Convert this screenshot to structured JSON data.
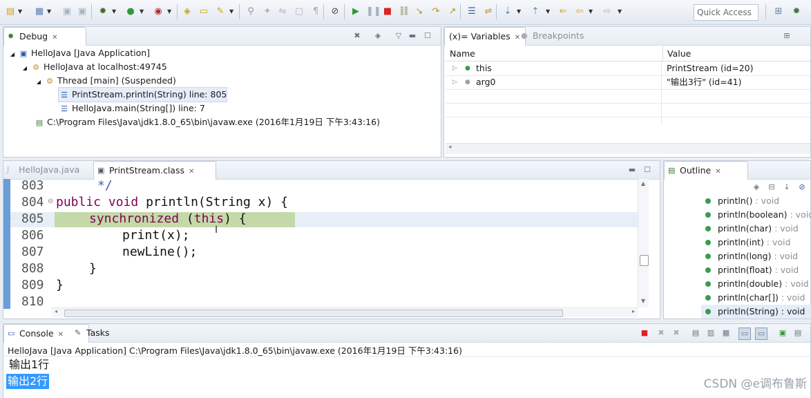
{
  "toolbar": {
    "icons": [
      "new-file-icon",
      "new-wizard-icon",
      "save-icon",
      "save-all-icon",
      "debug-icon",
      "run-icon",
      "external-tools-icon",
      "open-type-icon",
      "open-folder-icon",
      "open-task-icon",
      "search-icon",
      "skip-breakpoints-icon",
      "resume-icon",
      "suspend-icon",
      "terminate-icon",
      "disconnect-icon",
      "step-into-icon",
      "step-over-icon",
      "step-return-icon",
      "drop-to-frame-icon",
      "use-step-filters-icon",
      "next-annotation-icon",
      "back-icon",
      "forward-icon"
    ],
    "quick_access_placeholder": "Quick Access"
  },
  "debug_view": {
    "tab_label": "Debug",
    "tree": [
      {
        "label": "HelloJava [Java Application]",
        "icon": "java-app-icon",
        "level": 0
      },
      {
        "label": "HelloJava at localhost:49745",
        "icon": "vm-icon",
        "level": 1
      },
      {
        "label": "Thread [main] (Suspended)",
        "icon": "thread-icon",
        "level": 2
      },
      {
        "label": "PrintStream.println(String) line: 805",
        "icon": "stack-frame-icon",
        "level": 3,
        "selected": true
      },
      {
        "label": "HelloJava.main(String[]) line: 7",
        "icon": "stack-frame-icon",
        "level": 3
      },
      {
        "label": "C:\\Program Files\\Java\\jdk1.8.0_65\\bin\\javaw.exe (2016年1月19日 下午3:43:16)",
        "icon": "process-icon",
        "level": 1
      }
    ]
  },
  "variables_view": {
    "tab_label": "(x)= Variables",
    "breakpoints_label": "Breakpoints",
    "columns": [
      "Name",
      "Value"
    ],
    "rows": [
      {
        "name": "this",
        "value": "PrintStream  (id=20)"
      },
      {
        "name": "arg0",
        "value": "\"输出3行\" (id=41)"
      }
    ]
  },
  "editor": {
    "tabs": [
      {
        "label": "HelloJava.java",
        "active": false
      },
      {
        "label": "PrintStream.class",
        "active": true
      }
    ],
    "lines": [
      {
        "number": "803",
        "text": "*/",
        "kind": "comment",
        "indent": 1
      },
      {
        "number": "804",
        "text": "public void println(String x) {",
        "kind": "method-decl",
        "indent": 0
      },
      {
        "number": "805",
        "text": "synchronized (this) {",
        "kind": "sync",
        "indent": 1,
        "highlighted": true
      },
      {
        "number": "806",
        "text": "print(x);",
        "kind": "plain",
        "indent": 2
      },
      {
        "number": "807",
        "text": "newLine();",
        "kind": "plain",
        "indent": 2
      },
      {
        "number": "808",
        "text": "}",
        "kind": "plain",
        "indent": 1
      },
      {
        "number": "809",
        "text": "}",
        "kind": "plain",
        "indent": 0
      },
      {
        "number": "810",
        "text": "",
        "kind": "plain",
        "indent": 0
      }
    ],
    "highlight_color": "#c4d9a8"
  },
  "outline_view": {
    "tab_label": "Outline",
    "items": [
      {
        "name": "println()",
        "type": ": void"
      },
      {
        "name": "println(boolean)",
        "type": ": void"
      },
      {
        "name": "println(char)",
        "type": ": void"
      },
      {
        "name": "println(int)",
        "type": ": void"
      },
      {
        "name": "println(long)",
        "type": ": void"
      },
      {
        "name": "println(float)",
        "type": ": void"
      },
      {
        "name": "println(double)",
        "type": ": void"
      },
      {
        "name": "println(char[])",
        "type": ": void"
      },
      {
        "name": "println(String)",
        "type": ": void",
        "selected": true
      }
    ]
  },
  "console_view": {
    "tab_label": "Console",
    "tasks_label": "Tasks",
    "launch_path": "HelloJava [Java Application] C:\\Program Files\\Java\\jdk1.8.0_65\\bin\\javaw.exe (2016年1月19日 下午3:43:16)",
    "output": [
      "输出1行",
      "输出2行"
    ],
    "selection_color": "#3399ff"
  },
  "watermark": "CSDN @e调布鲁斯"
}
